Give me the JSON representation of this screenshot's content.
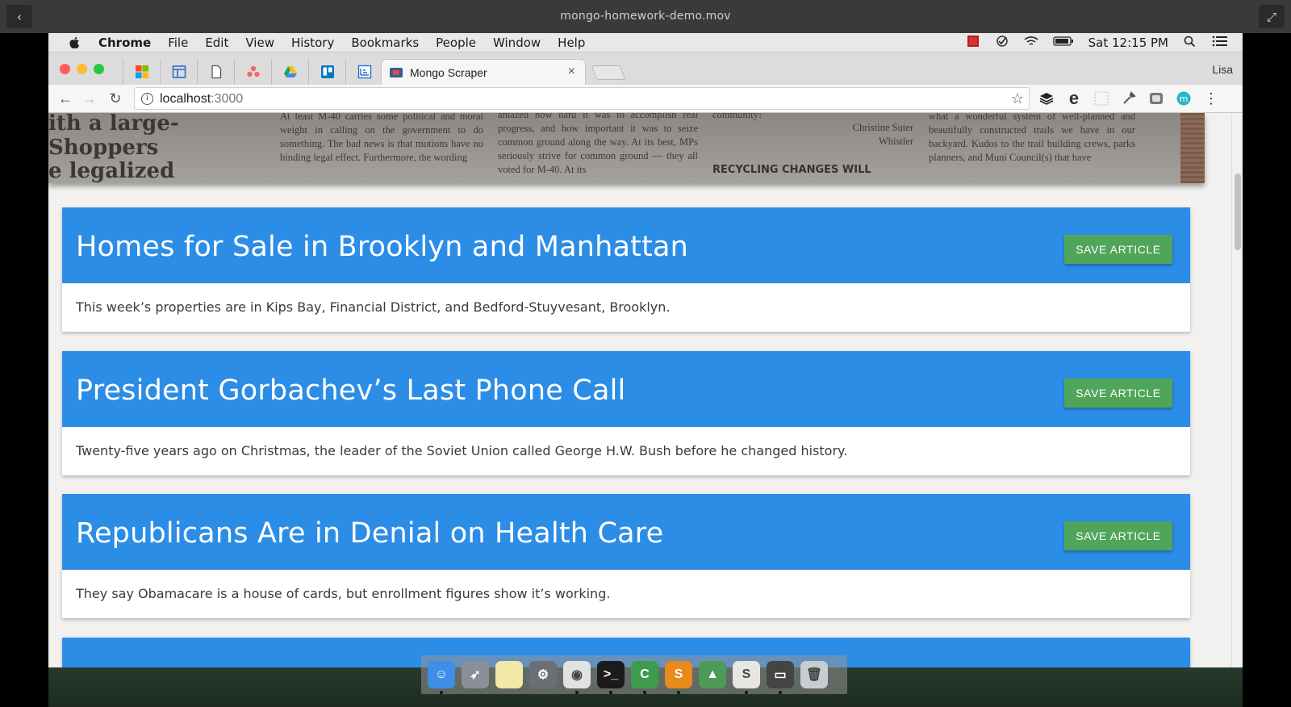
{
  "player": {
    "title": "mongo-homework-demo.mov"
  },
  "menubar": {
    "app": "Chrome",
    "items": [
      "File",
      "Edit",
      "View",
      "History",
      "Bookmarks",
      "People",
      "Window",
      "Help"
    ],
    "clock": "Sat 12:15 PM"
  },
  "tabs": {
    "active_title": "Mongo Scraper",
    "close_glyph": "×",
    "profile": "Lisa",
    "pinned_icons": [
      "windows-icon",
      "layout-icon",
      "document-icon",
      "asana-icon",
      "drive-icon",
      "trello-icon",
      "chart-icon"
    ]
  },
  "omnibox": {
    "host": "localhost",
    "port": ":3000",
    "star_glyph": "☆"
  },
  "nav": {
    "back": "←",
    "forward": "→",
    "reload": "↻"
  },
  "hero": {
    "headlines": [
      "ith a large-",
      "Shoppers",
      "e legalized"
    ],
    "col1": "At least M-40 carries some political and moral weight in calling on the government to do something. The bad news is that motions have no binding legal effect. Furthermore, the wording",
    "col2": "amazed how hard it was to accomplish real progress, and how important it was to seize common ground along the way. At its best, MPs seriously strive for common ground — they all voted for M-40. At its",
    "col3_top": "community!",
    "col3_bold": "RECYCLING CHANGES WILL",
    "signature": [
      "Christine Suter",
      "Whistler"
    ],
    "col4": "what a wonderful system of well-planned and beautifully constructed trails we have in our backyard. Kudos to the trail building crews, parks planners, and Muni Council(s) that have"
  },
  "articles": [
    {
      "title": "Homes for Sale in Brooklyn and Manhattan",
      "summary": "This week’s properties are in Kips Bay, Financial District, and Bedford-Stuyvesant, Brooklyn.",
      "button": "SAVE ARTICLE"
    },
    {
      "title": "President Gorbachev’s Last Phone Call",
      "summary": "Twenty-five years ago on Christmas, the leader of the Soviet Union called George H.W. Bush before he changed history.",
      "button": "SAVE ARTICLE"
    },
    {
      "title": "Republicans Are in Denial on Health Care",
      "summary": "They say Obamacare is a house of cards, but enrollment figures show it’s working.",
      "button": "SAVE ARTICLE"
    }
  ],
  "dock": {
    "apps": [
      {
        "name": "finder-icon",
        "color": "#3d8ee6",
        "glyph": "☺"
      },
      {
        "name": "launchpad-icon",
        "color": "#8a8f98",
        "glyph": "➶"
      },
      {
        "name": "notes-icon",
        "color": "#f2e8a8",
        "glyph": ""
      },
      {
        "name": "system-preferences-icon",
        "color": "#6b6f75",
        "glyph": "⚙"
      },
      {
        "name": "chrome-icon",
        "color": "#e2e2e2",
        "glyph": "◉"
      },
      {
        "name": "terminal-icon",
        "color": "#1b1b1b",
        "glyph": ">_"
      },
      {
        "name": "excel-icon",
        "color": "#3f9b4c",
        "glyph": "C"
      },
      {
        "name": "sublime-icon",
        "color": "#e88a1c",
        "glyph": "S"
      },
      {
        "name": "robo3t-icon",
        "color": "#4e9a58",
        "glyph": "▲"
      },
      {
        "name": "slack-icon",
        "color": "#e8e6e0",
        "glyph": "S"
      },
      {
        "name": "display-icon",
        "color": "#444",
        "glyph": "▭"
      },
      {
        "name": "trash-icon",
        "color": "#c9ccd1",
        "glyph": "🗑"
      }
    ]
  },
  "colors": {
    "card_header": "#2b8de6",
    "save_button": "#4fa55a"
  }
}
